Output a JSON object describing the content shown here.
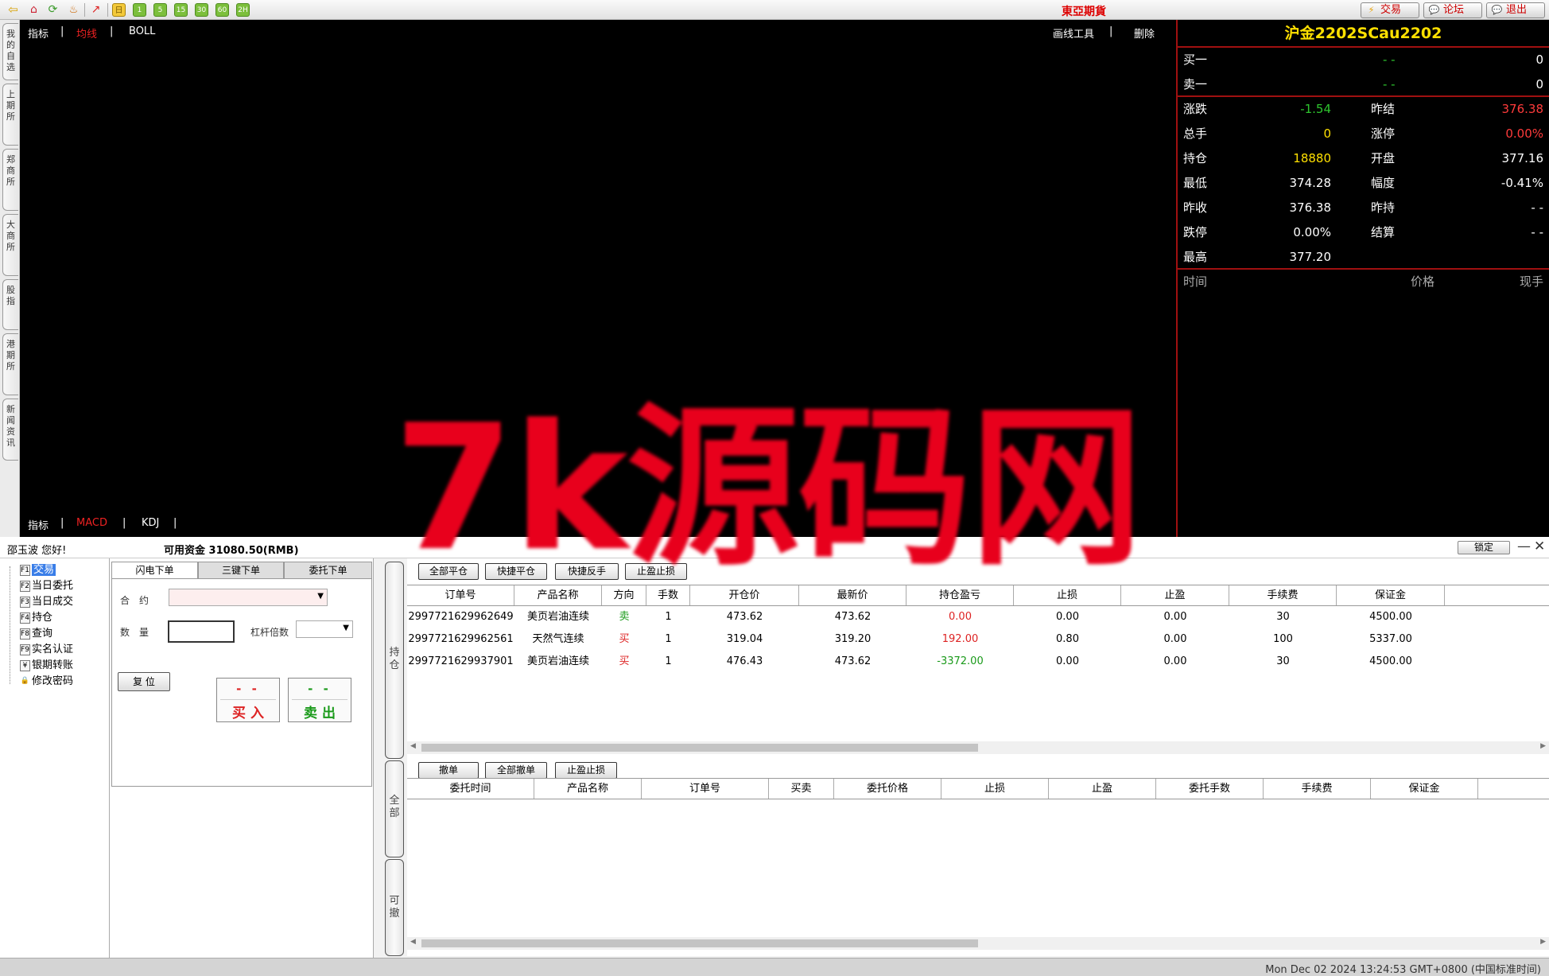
{
  "toolbar": {
    "brand": "東亞期貨",
    "nums": [
      "1",
      "5",
      "15",
      "30",
      "60",
      "2H"
    ],
    "trade": "交易",
    "forum": "论坛",
    "exit": "退出"
  },
  "side_tabs": [
    "我的自选",
    "上期所",
    "郑商所",
    "大商所",
    "股指",
    "港期所",
    "新闻资讯"
  ],
  "chart": {
    "top_indicator": "指标",
    "top_ma": "均线",
    "top_boll": "BOLL",
    "draw_tool": "画线工具",
    "delete": "删除",
    "bottom_indicator": "指标",
    "bottom_macd": "MACD",
    "bottom_kdj": "KDJ",
    "separator": "|"
  },
  "quote": {
    "title": "沪金2202SCau2202",
    "bid1": {
      "label": "买一",
      "price": "- -",
      "vol": "0"
    },
    "ask1": {
      "label": "卖一",
      "price": "- -",
      "vol": "0"
    },
    "rows": [
      {
        "l1": "涨跌",
        "v1": "-1.54",
        "l2": "昨结",
        "v2": "376.38"
      },
      {
        "l1": "总手",
        "v1": "0",
        "l2": "涨停",
        "v2": "0.00%"
      },
      {
        "l1": "持仓",
        "v1": "18880",
        "l2": "开盘",
        "v2": "377.16"
      },
      {
        "l1": "最低",
        "v1": "374.28",
        "l2": "幅度",
        "v2": "-0.41%"
      },
      {
        "l1": "昨收",
        "v1": "376.38",
        "l2": "昨持",
        "v2": "- -"
      },
      {
        "l1": "跌停",
        "v1": "0.00%",
        "l2": "结算",
        "v2": "- -"
      },
      {
        "l1": "最高",
        "v1": "377.20",
        "l2": "",
        "v2": ""
      }
    ],
    "tick_head": {
      "time": "时间",
      "price": "价格",
      "vol": "现手"
    }
  },
  "watermark": "7k源码网",
  "status": {
    "user": "邵玉波 您好!",
    "funds": "可用资金 31080.50(RMB)",
    "lock": "锁定",
    "minimize": "—",
    "close": "✕"
  },
  "tree": [
    {
      "key": "F1",
      "label": "交易"
    },
    {
      "key": "F2",
      "label": "当日委托"
    },
    {
      "key": "F3",
      "label": "当日成交"
    },
    {
      "key": "F4",
      "label": "持仓"
    },
    {
      "key": "F8",
      "label": "查询"
    },
    {
      "key": "F9",
      "label": "实名认证"
    },
    {
      "key": "¥",
      "label": "银期转账"
    },
    {
      "key": "🔒",
      "label": "修改密码"
    }
  ],
  "order": {
    "tabs": [
      "闪电下单",
      "三键下单",
      "委托下单"
    ],
    "contract_label": "合　约",
    "qty_label": "数　量",
    "leverage_label": "杠杆倍数",
    "reset": "复 位",
    "buy_dash": "- -",
    "buy": "买 入",
    "sell_dash": "- -",
    "sell": "卖 出"
  },
  "vtabs": {
    "pos": "持仓",
    "all": "全部",
    "cancelable": "可撤"
  },
  "positions": {
    "buttons": [
      "全部平仓",
      "快捷平仓",
      "快捷反手",
      "止盈止损"
    ],
    "headers": [
      "订单号",
      "产品名称",
      "方向",
      "手数",
      "开仓价",
      "最新价",
      "持仓盈亏",
      "止损",
      "止盈",
      "手续费",
      "保证金"
    ],
    "rows": [
      [
        "2997721629962649",
        "美页岩油连续",
        "卖",
        "1",
        "473.62",
        "473.62",
        "0.00",
        "0.00",
        "0.00",
        "30",
        "4500.00"
      ],
      [
        "2997721629962561",
        "天然气连续",
        "买",
        "1",
        "319.04",
        "319.20",
        "192.00",
        "0.80",
        "0.00",
        "100",
        "5337.00"
      ],
      [
        "2997721629937901",
        "美页岩油连续",
        "买",
        "1",
        "476.43",
        "473.62",
        "-3372.00",
        "0.00",
        "0.00",
        "30",
        "4500.00"
      ]
    ]
  },
  "orders": {
    "buttons": [
      "撤单",
      "全部撤单",
      "止盈止损"
    ],
    "headers": [
      "委托时间",
      "产品名称",
      "订单号",
      "买卖",
      "委托价格",
      "止损",
      "止盈",
      "委托手数",
      "手续费",
      "保证金"
    ]
  },
  "footer": {
    "time": "Mon Dec 02 2024 13:24:53 GMT+0800 (中国标准时间)"
  },
  "colors": {
    "accent_red": "#ee2222",
    "up_green": "#2ec52e",
    "quote_yellow": "#ffe000",
    "panel_border": "#a01010"
  }
}
